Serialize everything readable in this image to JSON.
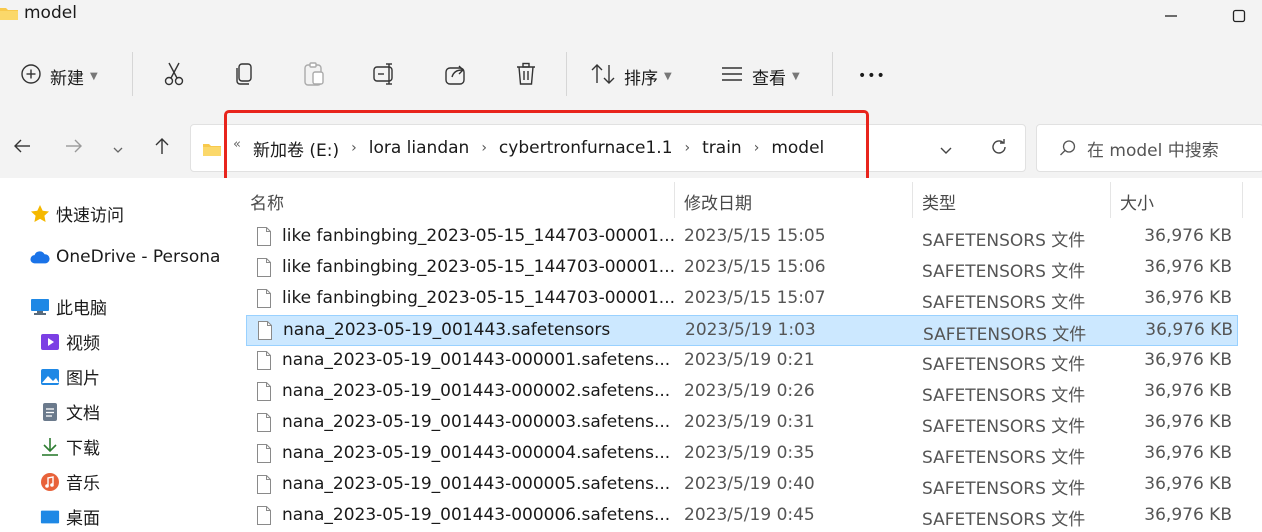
{
  "window": {
    "title": "model"
  },
  "toolbar": {
    "new_label": "新建",
    "sort_label": "排序",
    "view_label": "查看",
    "more_label": "•••"
  },
  "navigation": {
    "breadcrumb_overflow": "«",
    "breadcrumb": [
      "新加卷 (E:)",
      "lora liandan",
      "cybertronfurnace1.1",
      "train",
      "model"
    ],
    "search_placeholder": "在 model 中搜索"
  },
  "sidebar": {
    "items": [
      {
        "label": "快速访问",
        "icon": "star-icon",
        "color": "#f5b800"
      },
      {
        "label": "OneDrive - Persona",
        "icon": "cloud-icon",
        "color": "#1a73e8"
      },
      {
        "label": "此电脑",
        "icon": "computer-icon",
        "color": "#1e88e5"
      },
      {
        "label": "视频",
        "icon": "video-icon",
        "color": "#7b3fe4"
      },
      {
        "label": "图片",
        "icon": "pictures-icon",
        "color": "#1e88e5"
      },
      {
        "label": "文档",
        "icon": "documents-icon",
        "color": "#6b7a8c"
      },
      {
        "label": "下载",
        "icon": "download-icon",
        "color": "#2e7d32"
      },
      {
        "label": "音乐",
        "icon": "music-icon",
        "color": "#e8623a"
      },
      {
        "label": "桌面",
        "icon": "desktop-icon",
        "color": "#1e88e5"
      }
    ]
  },
  "columns": {
    "name": "名称",
    "date": "修改日期",
    "type": "类型",
    "size": "大小"
  },
  "files": [
    {
      "name": "like fanbingbing_2023-05-15_144703-00001...",
      "date": "2023/5/15 15:05",
      "type": "SAFETENSORS 文件",
      "size": "36,976 KB"
    },
    {
      "name": "like fanbingbing_2023-05-15_144703-00001...",
      "date": "2023/5/15 15:06",
      "type": "SAFETENSORS 文件",
      "size": "36,976 KB"
    },
    {
      "name": "like fanbingbing_2023-05-15_144703-00001...",
      "date": "2023/5/15 15:07",
      "type": "SAFETENSORS 文件",
      "size": "36,976 KB"
    },
    {
      "name": "nana_2023-05-19_001443.safetensors",
      "date": "2023/5/19 1:03",
      "type": "SAFETENSORS 文件",
      "size": "36,976 KB",
      "selected": true
    },
    {
      "name": "nana_2023-05-19_001443-000001.safetens...",
      "date": "2023/5/19 0:21",
      "type": "SAFETENSORS 文件",
      "size": "36,976 KB"
    },
    {
      "name": "nana_2023-05-19_001443-000002.safetens...",
      "date": "2023/5/19 0:26",
      "type": "SAFETENSORS 文件",
      "size": "36,976 KB"
    },
    {
      "name": "nana_2023-05-19_001443-000003.safetens...",
      "date": "2023/5/19 0:31",
      "type": "SAFETENSORS 文件",
      "size": "36,976 KB"
    },
    {
      "name": "nana_2023-05-19_001443-000004.safetens...",
      "date": "2023/5/19 0:35",
      "type": "SAFETENSORS 文件",
      "size": "36,976 KB"
    },
    {
      "name": "nana_2023-05-19_001443-000005.safetens...",
      "date": "2023/5/19 0:40",
      "type": "SAFETENSORS 文件",
      "size": "36,976 KB"
    },
    {
      "name": "nana_2023-05-19_001443-000006.safetens...",
      "date": "2023/5/19 0:45",
      "type": "SAFETENSORS 文件",
      "size": "36,976 KB"
    }
  ],
  "colors": {
    "selection": "#cce8ff",
    "highlight_box": "#e8241c",
    "folder": "#f8c94c"
  }
}
